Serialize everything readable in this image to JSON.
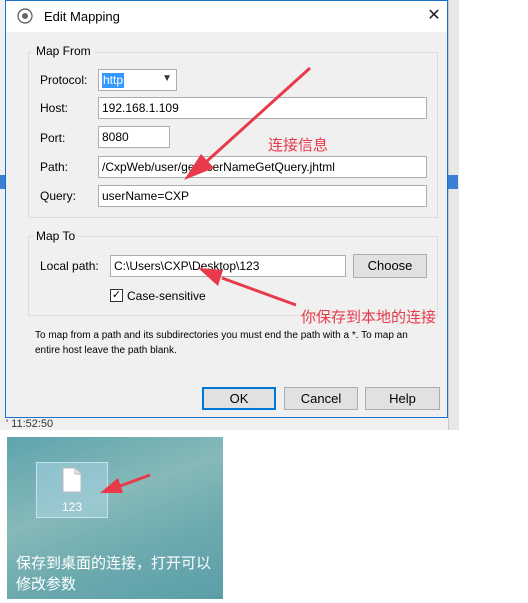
{
  "window": {
    "title": "Edit Mapping",
    "close_glyph": "✕"
  },
  "map_from": {
    "legend": "Map From",
    "protocol_label": "Protocol:",
    "protocol_value": "http",
    "host_label": "Host:",
    "host_value": "192.168.1.109",
    "port_label": "Port:",
    "port_value": "8080",
    "path_label": "Path:",
    "path_value": "/CxpWeb/user/getUserNameGetQuery.jhtml",
    "query_label": "Query:",
    "query_value": "userName=CXP"
  },
  "map_to": {
    "legend": "Map To",
    "local_path_label": "Local path:",
    "local_path_value": "C:\\Users\\CXP\\Desktop\\123",
    "choose_label": "Choose",
    "case_sensitive_label": "Case-sensitive",
    "case_sensitive_checked": true
  },
  "hint_text": "To map from a path and its subdirectories you must end the path with a *. To map an entire host leave the path blank.",
  "buttons": {
    "ok": "OK",
    "cancel": "Cancel",
    "help": "Help"
  },
  "annotations": {
    "connection_info": "连接信息",
    "saved_local": "你保存到本地的连接",
    "desktop_caption": "保存到桌面的连接，打开可以修改参数"
  },
  "background": {
    "time": "' 11:52:50"
  },
  "desktop": {
    "file_name": "123"
  },
  "colors": {
    "annotation_red": "#e83a4a",
    "accent_blue": "#0078d7",
    "selection_blue": "#3399ff"
  }
}
